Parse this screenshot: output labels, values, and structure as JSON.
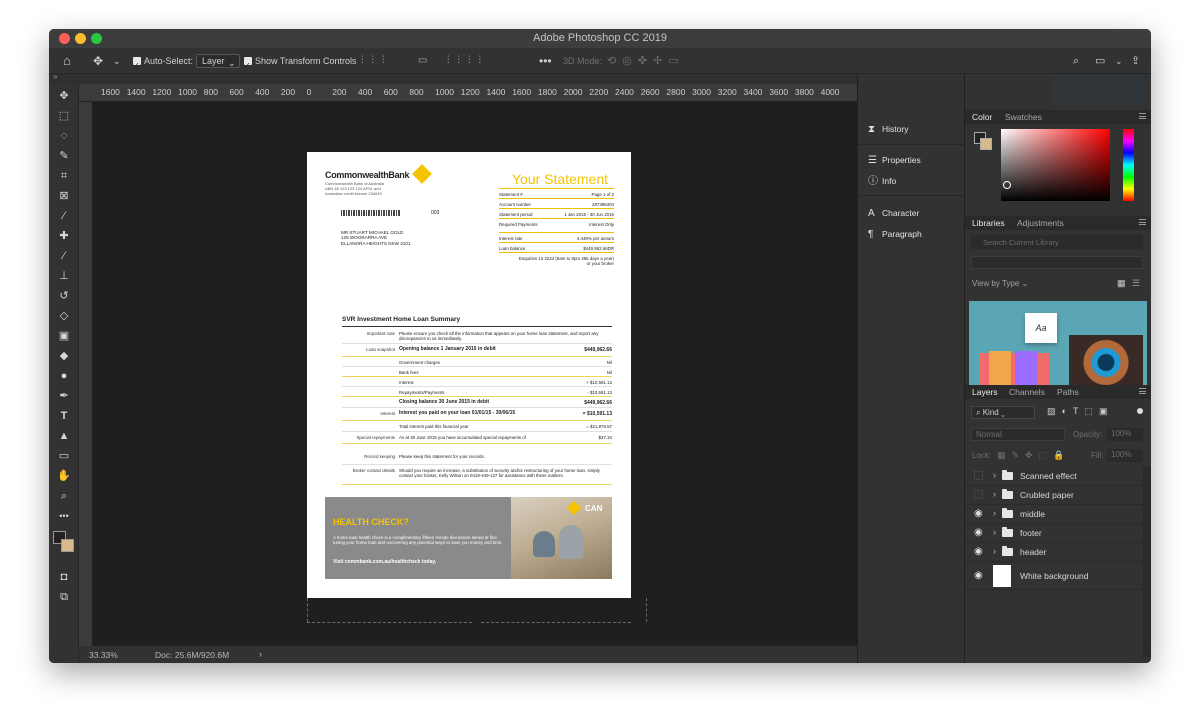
{
  "window": {
    "title": "Adobe Photoshop CC 2019"
  },
  "options_bar": {
    "auto_select_label": "Auto-Select:",
    "auto_select_target": "Layer",
    "show_transform_label": "Show Transform Controls",
    "mode_3d_label": "3D Mode:"
  },
  "ruler": {
    "top_ticks": [
      "1600",
      "1400",
      "1200",
      "1000",
      "800",
      "600",
      "400",
      "200",
      "0",
      "200",
      "400",
      "600",
      "800",
      "1000",
      "1200",
      "1400",
      "1600",
      "1800",
      "2000",
      "2200",
      "2400",
      "2600",
      "2800",
      "3000",
      "3200",
      "3400",
      "3600",
      "3800",
      "4000"
    ]
  },
  "status": {
    "zoom": "33.33%",
    "doc": "Doc: 25.6M/920.6M"
  },
  "panels_mid": {
    "history": "History",
    "properties": "Properties",
    "info": "Info",
    "character": "Character",
    "paragraph": "Paragraph"
  },
  "color_panel": {
    "tab_color": "Color",
    "tab_swatches": "Swatches"
  },
  "libraries_panel": {
    "tab_libraries": "Libraries",
    "tab_adjustments": "Adjustments",
    "search_placeholder": "Search Current Library",
    "view_by": "View by Type"
  },
  "layers_panel": {
    "tab_layers": "Layers",
    "tab_channels": "Channels",
    "tab_paths": "Paths",
    "kind": "Kind",
    "blend": "Normal",
    "opacity_label": "Opacity:",
    "opacity_value": "100%",
    "lock_label": "Lock:",
    "fill_label": "Fill:",
    "fill_value": "100%",
    "layers": [
      {
        "name": "Scanned effect",
        "visible": false,
        "type": "group"
      },
      {
        "name": "Crubled paper",
        "visible": false,
        "type": "group"
      },
      {
        "name": "middle",
        "visible": true,
        "type": "group"
      },
      {
        "name": "footer",
        "visible": true,
        "type": "group"
      },
      {
        "name": "header",
        "visible": true,
        "type": "group"
      },
      {
        "name": "White background",
        "visible": true,
        "type": "layer"
      }
    ]
  },
  "document": {
    "brand": "CommonwealthBank",
    "brand_sub1": "Commonwealth Bank of Australia",
    "brand_sub2": "ABN 48 123 123 124  AFSL and",
    "brand_sub3": "Australian credit licence 234945",
    "statement_title": "Your Statement",
    "ref_code": "003",
    "addr_1": "MR STUART MICHAEL GOLD",
    "addr_2": "125 WOORARRA AVE",
    "addr_3": "ELLANORA HEIGHTS NSW 2101",
    "info_rows": [
      {
        "k": "Statement #",
        "v": "Page 1 of 2"
      },
      {
        "k": "Account number",
        "v": "287396304"
      },
      {
        "k": "Statement period",
        "v": "1 Jan 2015 - 30 Jun 2015"
      },
      {
        "k": "Required Payments",
        "v": "Interest Only"
      },
      {
        "k": "Interest rate",
        "v": "4.449% per annum"
      },
      {
        "k": "Loan balance",
        "v": "$449,962.66DR"
      }
    ],
    "enquiries_1": "Enquiries 13 2224 (8am to 8pm 365 days a year)",
    "enquiries_2": "or your broker",
    "summary_title": "SVR Investment Home Loan Summary",
    "summary_rows": [
      {
        "label": "Important note",
        "desc": "Please ensure you check all the information that appears on your home loan statement, and report any discrepancies to us immediately.",
        "amt": "",
        "bold": false
      },
      {
        "label": "Loan snapshot",
        "desc": "Opening balance 1 January 2015 in debit",
        "amt": "$449,962.66",
        "bold": true
      },
      {
        "label": "",
        "desc": "Government charges",
        "amt": "Nil",
        "bold": false
      },
      {
        "label": "",
        "desc": "Bank fees",
        "amt": "Nil",
        "bold": false
      },
      {
        "label": "",
        "desc": "Interest",
        "amt": "+ $10,591.13",
        "bold": false
      },
      {
        "label": "",
        "desc": "Repayments/Payments",
        "amt": "- $10,591.13",
        "bold": false
      },
      {
        "label": "",
        "desc": "Closing balance 30 June 2015 in debit",
        "amt": "$449,962.66",
        "bold": true
      },
      {
        "label": "Interest",
        "desc": "Interest you paid on your loan 01/01/15 - 30/06/15",
        "amt": "= $10,591.13",
        "bold": true
      },
      {
        "label": "",
        "desc": "Total interest paid this financial year",
        "amt": "= $21,878.57",
        "bold": false
      },
      {
        "label": "Special repayments",
        "desc": "As at 30 June 2015 you have accumulated special repayments of",
        "amt": "$37.34",
        "bold": false
      },
      {
        "label": "Record keeping",
        "desc": "Please keep this statement for your records.",
        "amt": "",
        "bold": false
      },
      {
        "label": "Broker contact details",
        "desc": "Should you require an increase, a substitution of security and/or restructuring of your home loan, simply contact your broker, Kelly Wilson on 0418-449-127 for assistance with these matters.",
        "amt": "",
        "bold": false
      }
    ],
    "banner_title": "HEALTH CHECK?",
    "banner_body": "A home loan health check is a complimentary fifteen minute discussion aimed at fine tuning your home loan and uncovering any potential ways to save you money and time.",
    "banner_link": "Visit commbank.com.au/healthcheck today.",
    "banner_can": "CAN"
  },
  "colors": {
    "cba_yellow": "#f5c400",
    "banner_grey": "#8a8a8a",
    "foreground": "#222222",
    "background": "#d8b98a"
  }
}
